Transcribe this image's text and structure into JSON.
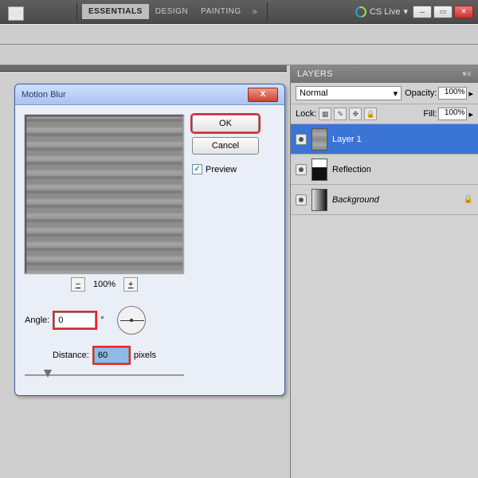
{
  "topbar": {
    "workspaces": [
      "ESSENTIALS",
      "DESIGN",
      "PAINTING"
    ],
    "active_workspace": 0,
    "more_glyph": "»",
    "cslive_label": "CS Live",
    "cslive_caret": "▾"
  },
  "panel": {
    "title": "LAYERS",
    "blend_mode": "Normal",
    "opacity_label": "Opacity:",
    "opacity_value": "100%",
    "lock_label": "Lock:",
    "fill_label": "Fill:",
    "fill_value": "100%",
    "caret": "▸",
    "layers": [
      {
        "name": "Layer 1",
        "selected": true,
        "italic": false,
        "locked": false,
        "thumb": "noise"
      },
      {
        "name": "Reflection",
        "selected": false,
        "italic": false,
        "locked": false,
        "thumb": "refl"
      },
      {
        "name": "Background",
        "selected": false,
        "italic": true,
        "locked": true,
        "thumb": "bg"
      }
    ]
  },
  "dialog": {
    "title": "Motion Blur",
    "ok_label": "OK",
    "cancel_label": "Cancel",
    "preview_label": "Preview",
    "preview_checked": true,
    "zoom_out": "−",
    "zoom_value": "100%",
    "zoom_in": "+",
    "angle_label": "Angle:",
    "angle_value": "0",
    "angle_unit": "°",
    "distance_label": "Distance:",
    "distance_value": "60",
    "distance_unit": "pixels"
  }
}
